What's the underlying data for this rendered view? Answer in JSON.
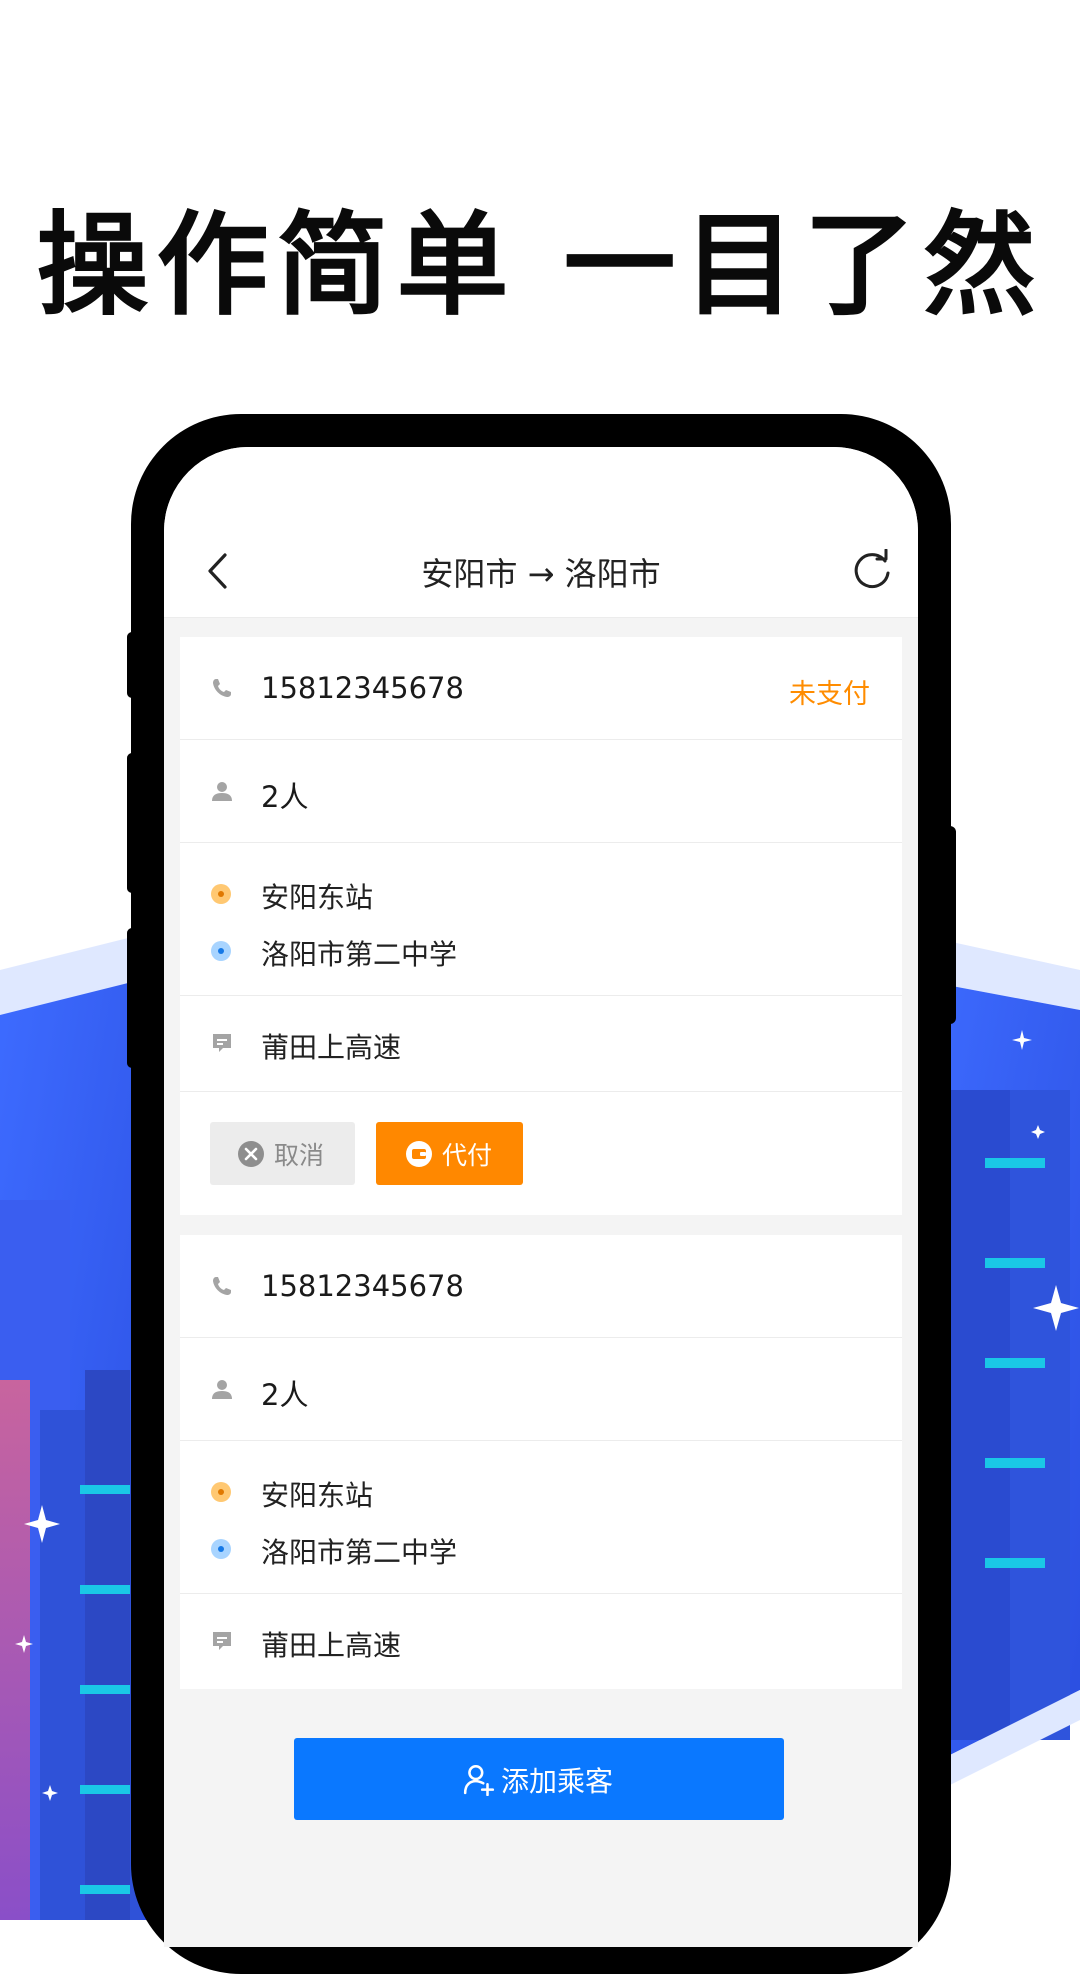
{
  "headline": "操作简单 一目了然",
  "nav": {
    "title": "安阳市 → 洛阳市",
    "back_icon": "chevron-left-icon",
    "refresh_icon": "refresh-icon"
  },
  "orders": [
    {
      "phone": "15812345678",
      "status": "未支付",
      "passengers": "2人",
      "from": "安阳东站",
      "to": "洛阳市第二中学",
      "note": "莆田上高速",
      "actions": {
        "cancel_label": "取消",
        "pay_label": "代付"
      }
    },
    {
      "phone": "15812345678",
      "passengers": "2人",
      "from": "安阳东站",
      "to": "洛阳市第二中学",
      "note": "莆田上高速"
    }
  ],
  "add_passenger_label": "添加乘客",
  "colors": {
    "accent_blue": "#0a78ff",
    "pay_orange": "#ff8800",
    "status_orange": "#ff8c00",
    "headline": "#0a0a0a"
  }
}
